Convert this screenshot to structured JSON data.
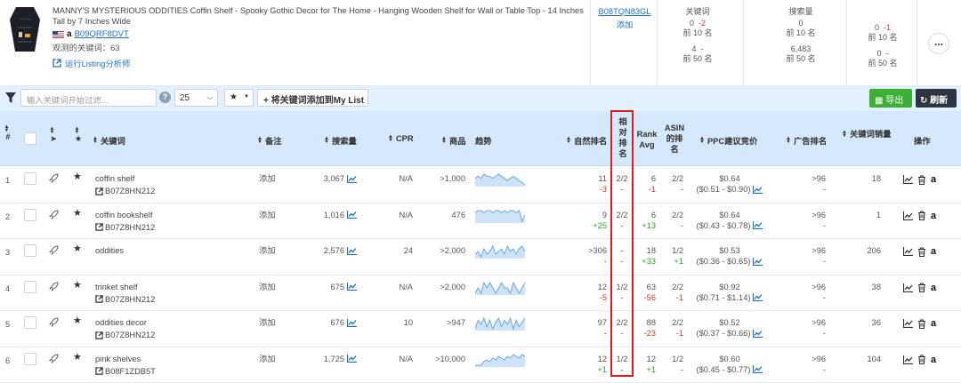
{
  "product": {
    "title": "MANNY'S MYSTERIOUS ODDITIES Coffin Shelf - Spooky Gothic Decor for The Home - Hanging Wooden Shelf for Wall or Table Top - 14 Inches Tall by 7 Inches Wide",
    "asin": "B09QRF8DVT",
    "keyword_count_label": "观测的关键词：63",
    "run_listing_label": "运行Listing分析师"
  },
  "competitor": {
    "asin": "B08TQN83GL",
    "add_label": "添加"
  },
  "metrics": {
    "keywords_header": "关键词",
    "search_volume_header": "搜索量",
    "kw_top10_value": "0",
    "kw_top10_delta": "-2",
    "kw_top10_label": "前 10 名",
    "kw_top50_value": "4",
    "kw_top50_delta": "-",
    "kw_top50_label": "前 50 名",
    "sv_top10_value": "0",
    "sv_top10_label": "前 10 名",
    "sv_top50_value": "6,483",
    "sv_top50_label": "前 50 名",
    "extra_top10_value": "0",
    "extra_top10_delta": "-1",
    "extra_top10_label": "前 10 名",
    "extra_top50_value": "0",
    "extra_top50_delta": "-",
    "extra_top50_label": "前 50 名",
    "more_label": "..."
  },
  "toolbar": {
    "filter_placeholder": "输入关键词开始过滤...",
    "help": "?",
    "page_size": "25",
    "add_to_list_label": "将关键词添加到My List",
    "export_label": "导出",
    "refresh_label": "刷新"
  },
  "columns": {
    "index": "#",
    "keyword": "关键词",
    "note": "备注",
    "search_volume": "搜索量",
    "cpr": "CPR",
    "products": "商品",
    "trend": "趋势",
    "organic_rank": "自然排名",
    "relative_rank_1": "相",
    "relative_rank_2": "对",
    "relative_rank_3": "排",
    "relative_rank_4": "名",
    "rank_avg_1": "Rank",
    "rank_avg_2": "Avg",
    "asin_rank_1": "ASIN",
    "asin_rank_2": "的排",
    "asin_rank_3": "名",
    "ppc_bid": "PPC建议竞价",
    "ad_rank": "广告排名",
    "kw_sales": "关键词销量",
    "actions": "操作"
  },
  "rows": [
    {
      "idx": "1",
      "keyword": "coffin shelf",
      "sub_asin": "B07Z8HN212",
      "note": "添加",
      "search_volume": "3,067",
      "cpr": "N/A",
      "products": ">1,000",
      "organic": "11",
      "organic_delta": "-3",
      "rel": "2/2",
      "rel_delta": "-",
      "rank_avg": "6",
      "rank_avg_delta": "-1",
      "asin_rank": "2/2",
      "asin_rank_delta": "-",
      "ppc": "$0.64",
      "ppc_range": "($0.51 - $0.90)",
      "ad_rank": ">96",
      "ad_rank_delta": "-",
      "kw_sales": "18",
      "trend": [
        5,
        6,
        5,
        7,
        6,
        6,
        5,
        6,
        7,
        6,
        5,
        4,
        5,
        6,
        5,
        4,
        3,
        2
      ]
    },
    {
      "idx": "2",
      "keyword": "coffin bookshelf",
      "sub_asin": "B07Z8HN212",
      "note": "添加",
      "search_volume": "1,016",
      "cpr": "N/A",
      "products": "476",
      "organic": "9",
      "organic_delta": "+25",
      "rel": "2/2",
      "rel_delta": "-",
      "rank_avg": "6",
      "rank_avg_delta": "+13",
      "asin_rank": "2/2",
      "asin_rank_delta": "-",
      "ppc": "$0.64",
      "ppc_range": "($0.43 - $0.78)",
      "ad_rank": ">96",
      "ad_rank_delta": "-",
      "kw_sales": "1",
      "trend": [
        6,
        7,
        7,
        6,
        7,
        7,
        6,
        7,
        7,
        6,
        7,
        6,
        7,
        7,
        6,
        7,
        2,
        5
      ]
    },
    {
      "idx": "3",
      "keyword": "oddities",
      "sub_asin": "",
      "note": "添加",
      "search_volume": "2,576",
      "cpr": "24",
      "products": ">2,000",
      "organic": ">306",
      "organic_delta": "-",
      "rel": "-",
      "rel_delta": "-",
      "rank_avg": "18",
      "rank_avg_delta": "+33",
      "asin_rank": "1/2",
      "asin_rank_delta": "+1",
      "ppc": "$0.53",
      "ppc_range": "($0.36 - $0.65)",
      "ad_rank": ">96",
      "ad_rank_delta": "-",
      "kw_sales": "206",
      "trend": [
        3,
        4,
        2,
        5,
        3,
        4,
        6,
        3,
        4,
        5,
        3,
        6,
        4,
        5,
        3,
        5,
        6,
        4
      ]
    },
    {
      "idx": "4",
      "keyword": "trinket shelf",
      "sub_asin": "B07Z8HN212",
      "note": "添加",
      "search_volume": "675",
      "cpr": "N/A",
      "products": ">2,000",
      "organic": "12",
      "organic_delta": "-5",
      "rel": "1/2",
      "rel_delta": "-",
      "rank_avg": "63",
      "rank_avg_delta": "-56",
      "asin_rank": "2/2",
      "asin_rank_delta": "-1",
      "ppc": "$0.92",
      "ppc_range": "($0.71 - $1.14)",
      "ad_rank": ">96",
      "ad_rank_delta": "-",
      "kw_sales": "38",
      "trend": [
        4,
        5,
        4,
        6,
        5,
        6,
        5,
        4,
        5,
        6,
        5,
        5,
        4,
        6,
        5,
        4,
        5,
        6
      ]
    },
    {
      "idx": "5",
      "keyword": "oddities decor",
      "sub_asin": "B07Z8HN212",
      "note": "添加",
      "search_volume": "676",
      "cpr": "10",
      "products": ">947",
      "organic": "97",
      "organic_delta": "-",
      "rel": "2/2",
      "rel_delta": "-",
      "rank_avg": "88",
      "rank_avg_delta": "-23",
      "asin_rank": "2/2",
      "asin_rank_delta": "-1",
      "ppc": "$0.52",
      "ppc_range": "($0.37 - $0.66)",
      "ad_rank": ">96",
      "ad_rank_delta": "-",
      "kw_sales": "36",
      "trend": [
        1,
        5,
        3,
        6,
        2,
        5,
        1,
        4,
        6,
        2,
        5,
        3,
        6,
        1,
        5,
        2,
        4,
        6
      ]
    },
    {
      "idx": "6",
      "keyword": "pink shelves",
      "sub_asin": "B08F1ZDB5T",
      "note": "添加",
      "search_volume": "1,725",
      "cpr": "N/A",
      "products": ">10,000",
      "organic": "12",
      "organic_delta": "+1",
      "rel": "1/2",
      "rel_delta": "-",
      "rank_avg": "12",
      "rank_avg_delta": "+1",
      "asin_rank": "1/2",
      "asin_rank_delta": "-",
      "ppc": "$0.60",
      "ppc_range": "($0.45 - $0.77)",
      "ad_rank": ">96",
      "ad_rank_delta": "-",
      "kw_sales": "104",
      "trend": [
        0,
        0,
        0,
        2,
        3,
        2,
        4,
        3,
        5,
        4,
        3,
        5,
        4,
        6,
        5,
        4,
        6,
        5
      ]
    }
  ]
}
